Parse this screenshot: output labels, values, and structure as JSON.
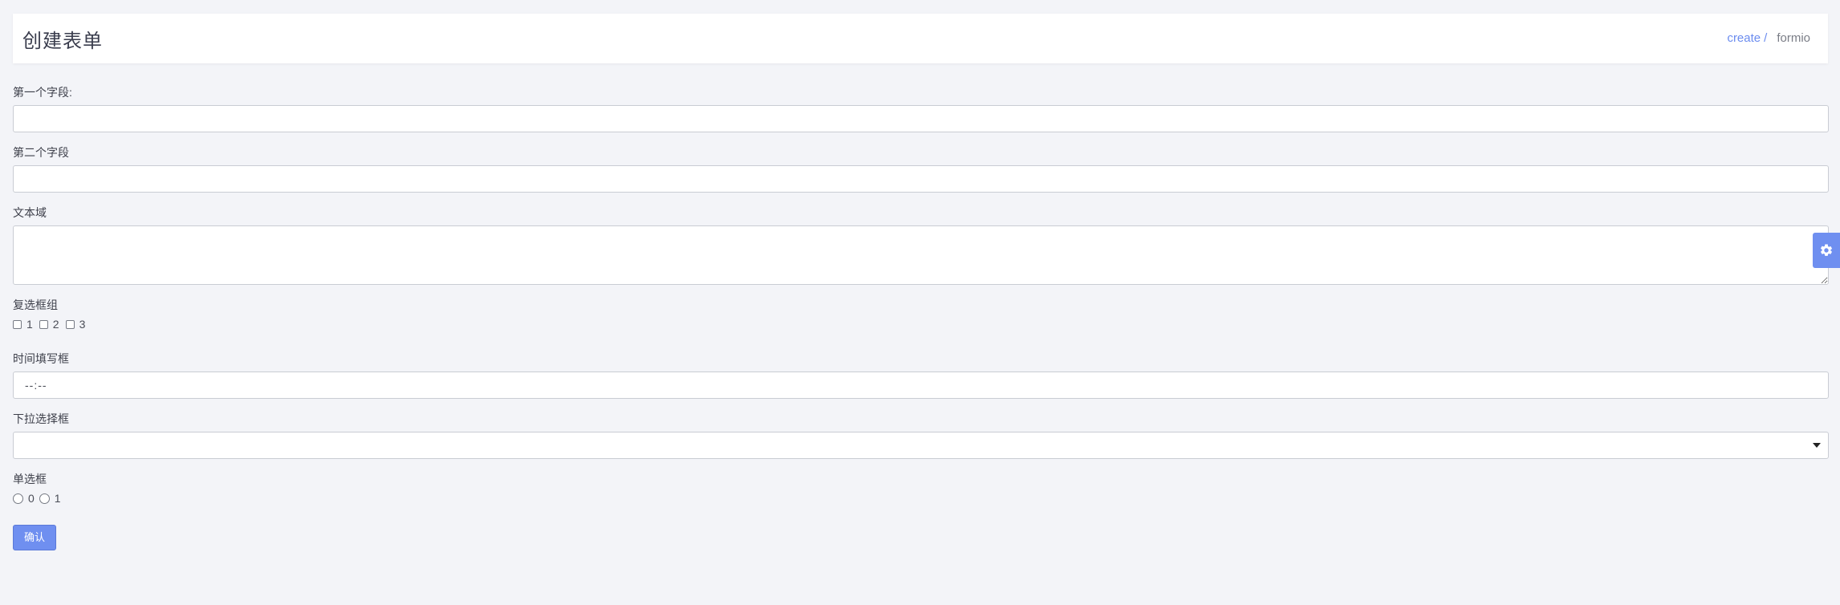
{
  "header": {
    "title": "创建表单",
    "breadcrumb": {
      "link": "create",
      "separator": "/",
      "current": "formio"
    }
  },
  "form": {
    "field1": {
      "label": "第一个字段:",
      "value": ""
    },
    "field2": {
      "label": "第二个字段",
      "value": ""
    },
    "textarea": {
      "label": "文本域",
      "value": ""
    },
    "checkbox_group": {
      "label": "复选框组",
      "options": [
        "1",
        "2",
        "3"
      ]
    },
    "time": {
      "label": "时间填写框",
      "value": "--:--"
    },
    "select": {
      "label": "下拉选择框",
      "value": ""
    },
    "radio": {
      "label": "单选框",
      "options": [
        "0",
        "1"
      ]
    },
    "submit_label": "确认"
  },
  "settings": {
    "icon": "gear-icon"
  },
  "colors": {
    "accent": "#6f8ff0",
    "background": "#f3f4f8",
    "link": "#6b8cef"
  }
}
